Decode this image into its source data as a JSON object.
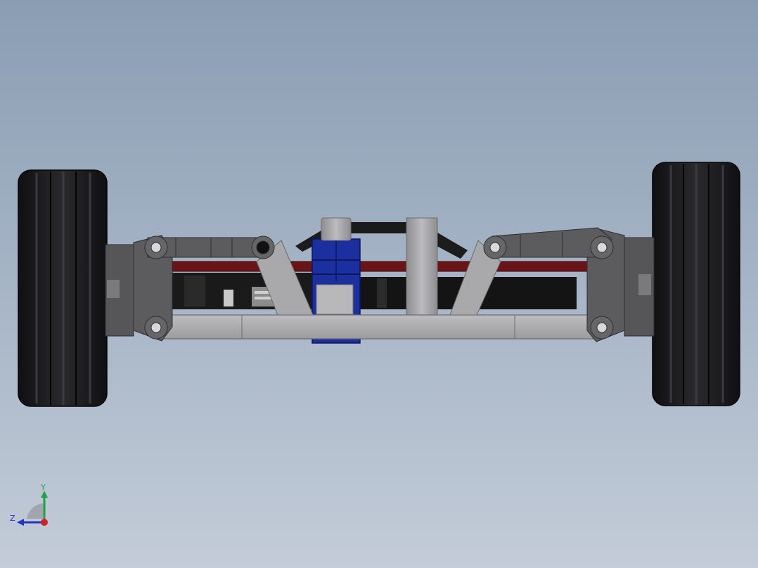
{
  "viewport": {
    "background_top": "#8a9db3",
    "background_bottom": "#c3ccd8"
  },
  "model": {
    "tire_color": "#1f1f21",
    "frame_color": "#a9a9ab",
    "arm_color": "#5c5c5f",
    "rod_color": "#6b1418",
    "servo_color": "#1c2f9e",
    "electronics_color": "#1a1a1a"
  },
  "triad": {
    "y_label": "Y",
    "z_label": "Z",
    "y_color": "#1fa34a",
    "z_color": "#2234c8",
    "x_color": "#d21f1f"
  }
}
